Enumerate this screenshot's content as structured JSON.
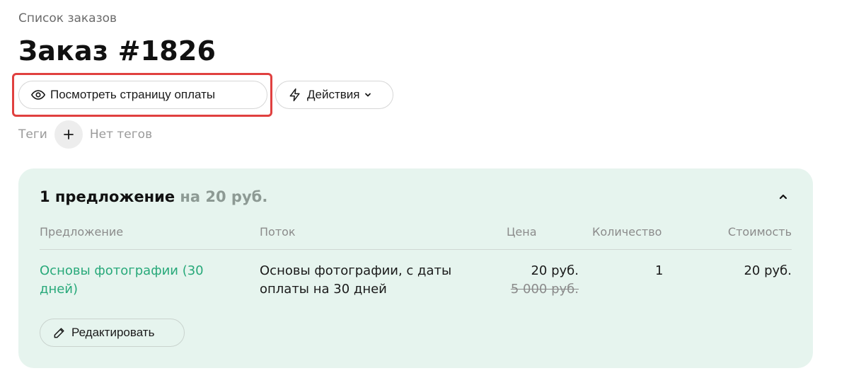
{
  "breadcrumb": "Список заказов",
  "title": "Заказ #1826",
  "toolbar": {
    "view_payment_label": "Посмотреть страницу оплаты",
    "actions_label": "Действия"
  },
  "tags": {
    "label": "Теги",
    "empty_text": "Нет тегов"
  },
  "offers": {
    "summary_count": "1 предложение",
    "summary_total": "на 20 руб.",
    "columns": {
      "offer": "Предложение",
      "stream": "Поток",
      "price": "Цена",
      "quantity": "Количество",
      "cost": "Стоимость"
    },
    "rows": [
      {
        "offer": "Основы фотографии (30 дней)",
        "stream": "Основы фотографии, с даты оплаты на 30 дней",
        "price": "20 руб.",
        "old_price": "5 000 руб.",
        "quantity": "1",
        "cost": "20 руб."
      }
    ],
    "edit_label": "Редактировать"
  },
  "colors": {
    "accent": "#28a97a",
    "card_background": "#e6f4ee",
    "highlight": "#e0403f"
  }
}
